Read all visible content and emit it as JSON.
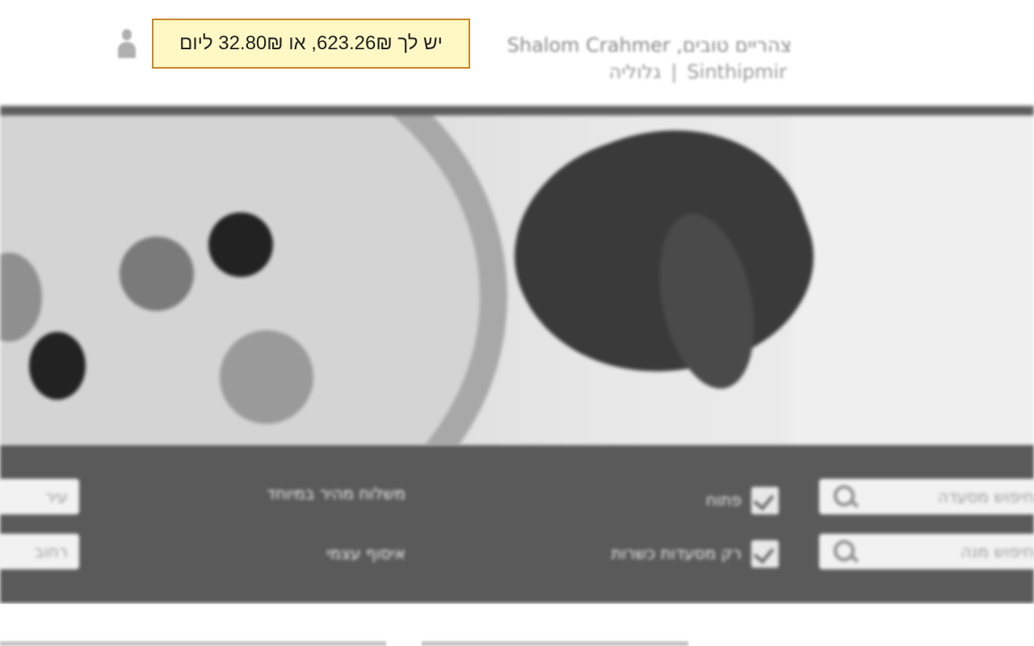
{
  "header": {
    "greeting": "צהריים טובים, Shalom Crahmer",
    "links": [
      "Sinthipmir",
      "גלוליה"
    ],
    "link_separator": "|"
  },
  "tooltip": {
    "text": "יש לך 623.26₪, או 32.80₪ ליום"
  },
  "search": {
    "restaurant_placeholder": "חיפוש מסעדה",
    "dish_placeholder": "חיפוש מנה",
    "city_value": "עיר",
    "address_value": "רחוב"
  },
  "filters": {
    "open_now_label": "פתוח",
    "kosher_label": "רק מסעדות כשרות",
    "delivery_label": "משלוח מהיר במיוחד",
    "pickup_label": "איסוף עצמי"
  },
  "colors": {
    "tooltip_bg": "#fff8c4",
    "tooltip_border": "#c9862a"
  }
}
